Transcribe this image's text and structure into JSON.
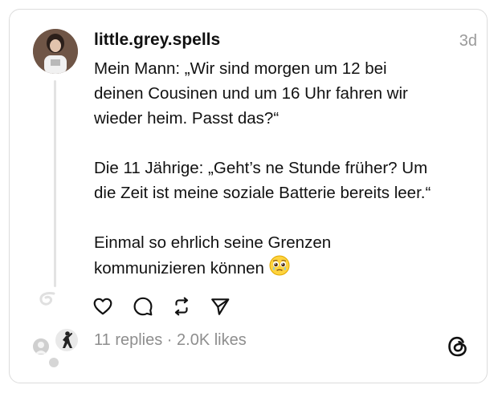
{
  "post": {
    "username": "little.grey.spells",
    "timestamp": "3d",
    "lines": [
      "Mein Mann: „Wir sind morgen um 12 bei",
      "deinen Cousinen und um 16 Uhr fahren wir",
      "wieder heim. Passt das?“",
      "Die 11 Jährige: „Geht’s ne Stunde früher? Um",
      "die Zeit ist meine soziale Batterie bereits leer.“",
      "Einmal so ehrlich seine Grenzen",
      "kommunizieren können"
    ],
    "emoji": "🥹",
    "stats": {
      "replies": "11 replies",
      "separator": " · ",
      "likes": "2.0K likes"
    }
  },
  "icons": {
    "like": "heart-icon",
    "reply": "comment-icon",
    "repost": "repost-icon",
    "share": "send-icon",
    "brand": "threads-logo-icon"
  }
}
